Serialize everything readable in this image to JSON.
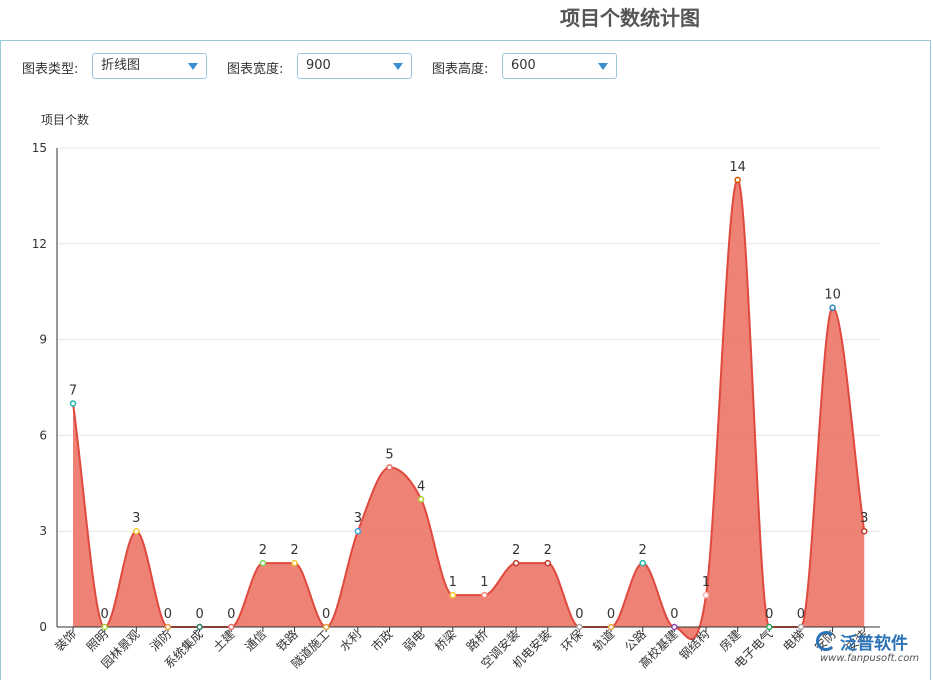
{
  "page": {
    "title": "项目个数统计图"
  },
  "controls": {
    "chart_type_label": "图表类型:",
    "chart_type_value": "折线图",
    "width_label": "图表宽度:",
    "width_value": "900",
    "height_label": "图表高度:",
    "height_value": "600"
  },
  "watermark": {
    "name": "泛普软件",
    "url": "www.fanpusoft.com"
  },
  "chart_data": {
    "type": "area",
    "title": "",
    "ylabel": "项目个数",
    "xlabel": "",
    "ylim": [
      0,
      15
    ],
    "yticks": [
      0,
      3,
      6,
      9,
      12,
      15
    ],
    "grid": true,
    "smooth": true,
    "categories": [
      "装饰",
      "照明",
      "园林景观",
      "消防",
      "系统集成",
      "土建",
      "通信",
      "铁路",
      "隧道施工",
      "水利",
      "市政",
      "弱电",
      "桥梁",
      "路桥",
      "空调安装",
      "机电安装",
      "环保",
      "轨道",
      "公路",
      "高校基建",
      "钢结构",
      "房建",
      "电子电气",
      "电梯",
      "安防",
      "安装"
    ],
    "values": [
      7,
      0,
      3,
      0,
      0,
      0,
      2,
      2,
      0,
      3,
      5,
      4,
      1,
      1,
      2,
      2,
      0,
      0,
      2,
      0,
      1,
      14,
      0,
      0,
      10,
      3
    ],
    "marker_colors": [
      "#1fb7b0",
      "#a8cf3a",
      "#f4c92e",
      "#e89a3c",
      "#247e5f",
      "#e5726a",
      "#7ed35c",
      "#f1c232",
      "#e6a23c",
      "#3aa5e8",
      "#e5726a",
      "#a8cf3a",
      "#f4c92e",
      "#f08a7a",
      "#c0392b",
      "#c0392b",
      "#aaaaaa",
      "#e6a23c",
      "#1fb7b0",
      "#8e44ad",
      "#f5b7b1",
      "#d35400",
      "#27ae60",
      "#aaaaaa",
      "#2e86c1",
      "#c0392b"
    ],
    "fill_color": "#ec7b6e",
    "line_color": "#e0493d"
  }
}
